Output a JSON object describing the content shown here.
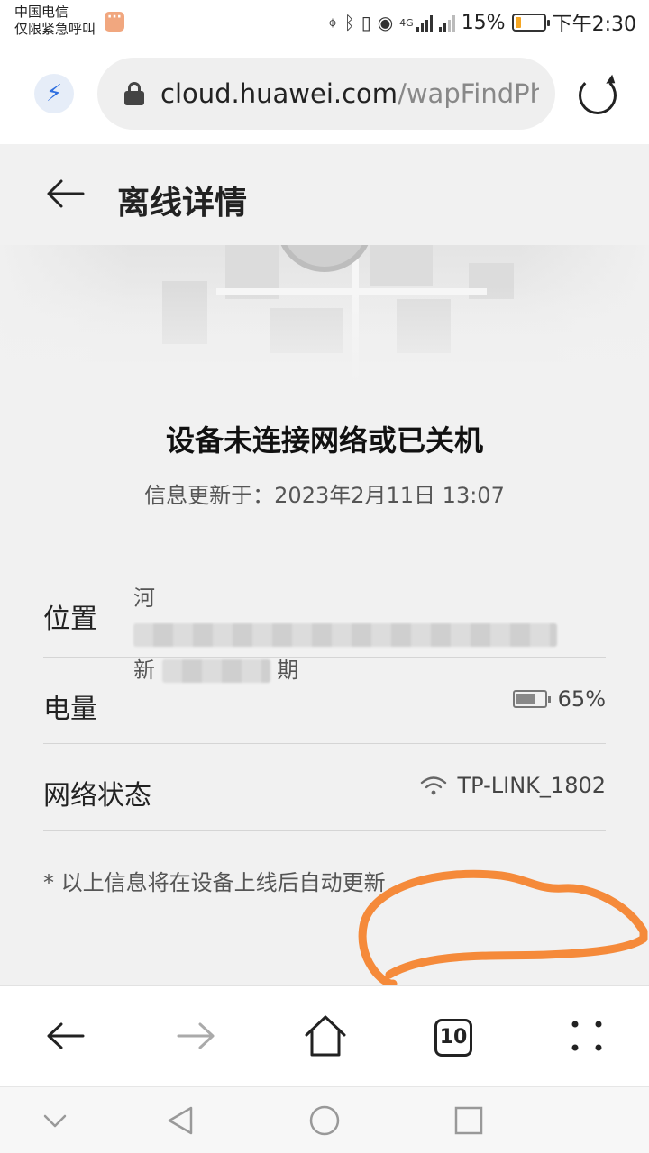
{
  "status_bar": {
    "carrier_line1": "中国电信",
    "carrier_line2": "仅限紧急呼叫",
    "battery_percent": "15%",
    "time": "下午2:30",
    "network_type": "4G"
  },
  "browser": {
    "url_host": "cloud.huawei.com",
    "url_path": "/wapFindPh"
  },
  "page": {
    "title": "离线详情",
    "headline": "设备未连接网络或已关机",
    "updated": "信息更新于：2023年2月11日 13:07",
    "rows": {
      "location": {
        "label": "位置",
        "line1_start": "河",
        "line2_start": "新",
        "line2_end": "期"
      },
      "battery": {
        "label": "电量",
        "value": "65%",
        "level": 0.65
      },
      "network": {
        "label": "网络状态",
        "value": "TP-LINK_1802"
      }
    },
    "note": "* 以上信息将在设备上线后自动更新"
  },
  "toolbar": {
    "tab_count": "10"
  },
  "colors": {
    "accent_blue": "#2f6fe0",
    "annotation_orange": "#f58a3a",
    "page_bg": "#f1f1f1"
  }
}
